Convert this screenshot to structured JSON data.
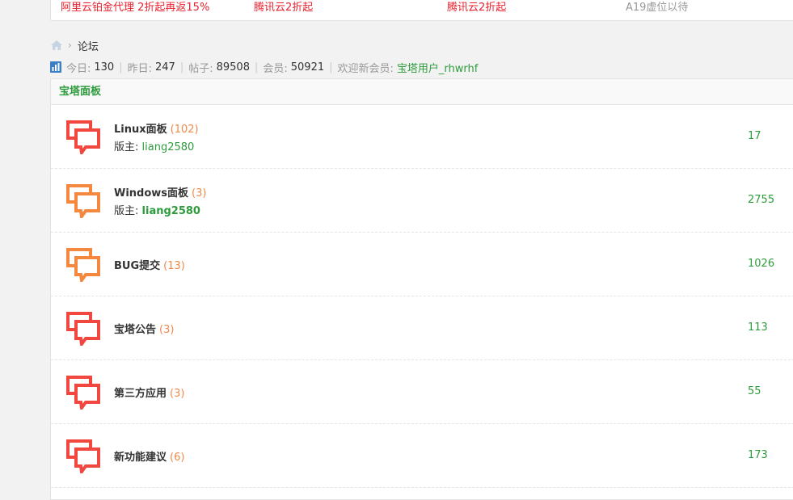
{
  "ads": [
    {
      "text": "阿里云铂金代理 2折起再返15%",
      "color": "red"
    },
    {
      "text": "腾讯云2折起",
      "color": "red"
    },
    {
      "text": "腾讯云2折起",
      "color": "red"
    },
    {
      "text": "A19虚位以待",
      "color": "gray"
    }
  ],
  "breadcrumb": {
    "current": "论坛"
  },
  "stats": {
    "today_label": "今日:",
    "today": "130",
    "yesterday_label": "昨日:",
    "yesterday": "247",
    "posts_label": "帖子:",
    "posts": "89508",
    "members_label": "会员:",
    "members": "50921",
    "welcome_label": "欢迎新会员:",
    "newest_member": "宝塔用户_rhwrhf"
  },
  "section": {
    "title": "宝塔面板"
  },
  "moderator_label": "版主:",
  "colors": {
    "accent_green": "#2e9b3c",
    "icon_red": "#f2473f",
    "icon_orange": "#f5883f",
    "count_orange": "#f08a4b"
  },
  "forums": [
    {
      "name": "Linux面板",
      "count": "(102)",
      "moderator": "liang2580",
      "moderator_bold": false,
      "icon_color": "red",
      "post_count": "17"
    },
    {
      "name": "Windows面板",
      "count": "(3)",
      "moderator": "liang2580",
      "moderator_bold": true,
      "icon_color": "orange",
      "post_count": "2755"
    },
    {
      "name": "BUG提交",
      "count": "(13)",
      "moderator": "",
      "moderator_bold": false,
      "icon_color": "orange",
      "post_count": "1026"
    },
    {
      "name": "宝塔公告",
      "count": "(3)",
      "moderator": "",
      "moderator_bold": false,
      "icon_color": "red",
      "post_count": "113"
    },
    {
      "name": "第三方应用",
      "count": "(3)",
      "moderator": "",
      "moderator_bold": false,
      "icon_color": "red",
      "post_count": "55"
    },
    {
      "name": "新功能建议",
      "count": "(6)",
      "moderator": "",
      "moderator_bold": false,
      "icon_color": "red",
      "post_count": "173"
    }
  ]
}
